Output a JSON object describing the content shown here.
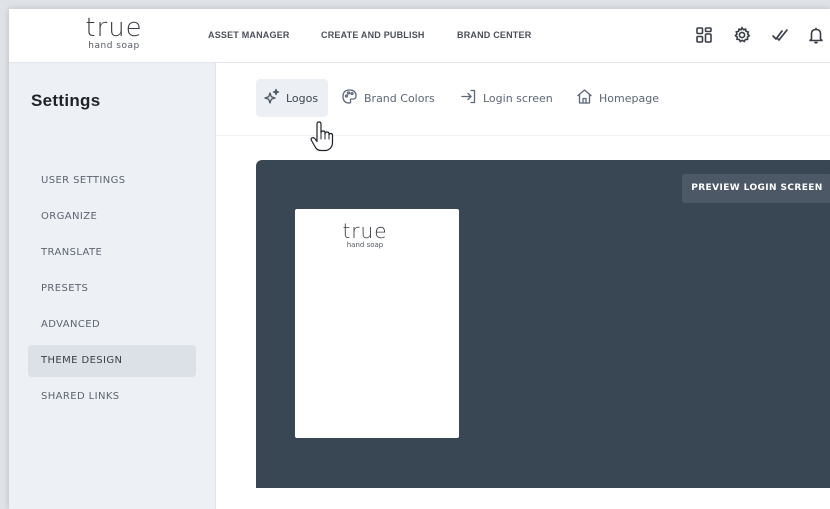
{
  "brand": {
    "logo_main": "true",
    "logo_sub": "hand soap"
  },
  "topnav": {
    "items": [
      {
        "label": "ASSET MANAGER"
      },
      {
        "label": "CREATE AND PUBLISH"
      },
      {
        "label": "BRAND CENTER"
      }
    ],
    "icons": [
      "apps-grid-icon",
      "gear-icon",
      "checkmarks-icon",
      "bell-icon"
    ]
  },
  "sidebar": {
    "title": "Settings",
    "items": [
      {
        "label": "USER SETTINGS",
        "active": false
      },
      {
        "label": "ORGANIZE",
        "active": false
      },
      {
        "label": "TRANSLATE",
        "active": false
      },
      {
        "label": "PRESETS",
        "active": false
      },
      {
        "label": "ADVANCED",
        "active": false
      },
      {
        "label": "THEME DESIGN",
        "active": true
      },
      {
        "label": "SHARED LINKS",
        "active": false
      }
    ]
  },
  "tabs": [
    {
      "label": "Logos",
      "icon": "sparkles-icon",
      "active": true
    },
    {
      "label": "Brand Colors",
      "icon": "palette-icon",
      "active": false
    },
    {
      "label": "Login screen",
      "icon": "login-arrow-icon",
      "active": false
    },
    {
      "label": "Homepage",
      "icon": "home-icon",
      "active": false
    }
  ],
  "preview": {
    "button_label": "PREVIEW LOGIN SCREEN",
    "card_logo_main": "true",
    "card_logo_sub": "hand soap"
  },
  "colors": {
    "preview_bg": "#394653",
    "sidebar_bg": "#edf0f4",
    "active_item_bg": "#dce1e8"
  }
}
